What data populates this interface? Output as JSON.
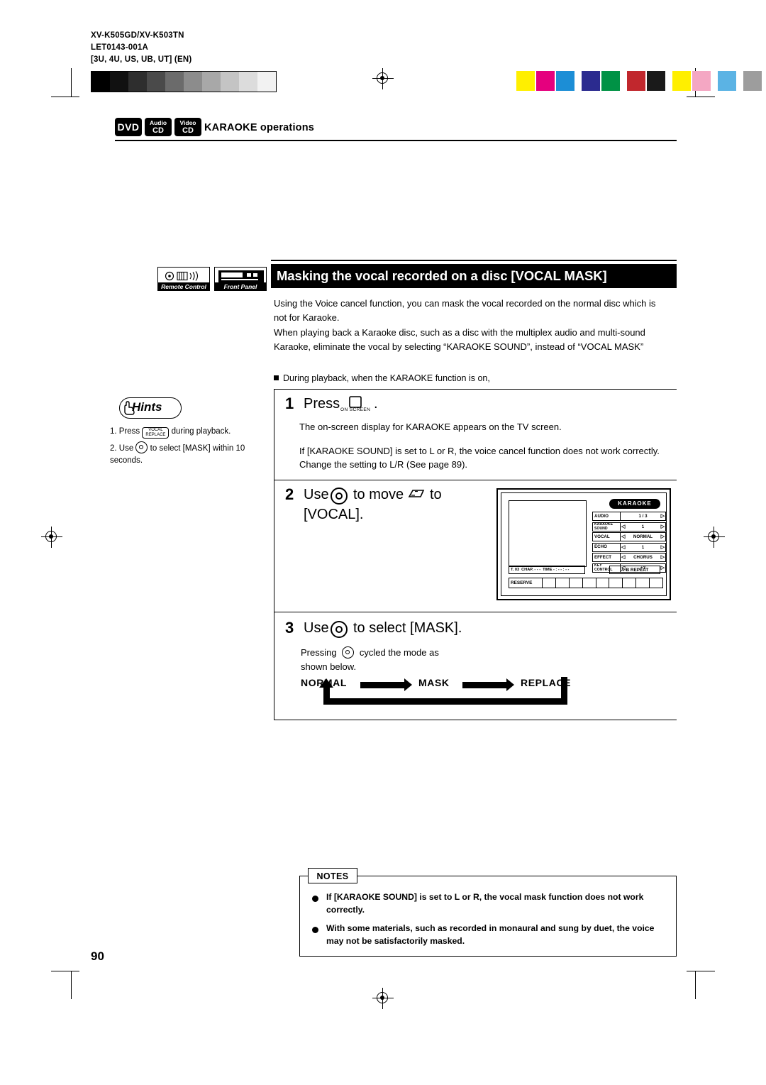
{
  "meta": {
    "model": "XV-K505GD/XV-K503TN",
    "code": "LET0143-001A",
    "region": "[3U, 4U, US, UB, UT]  (EN)"
  },
  "header": {
    "disc_icons": [
      {
        "name": "dvd",
        "line1": "",
        "line2": "DVD"
      },
      {
        "name": "audio-cd",
        "line1": "Audio",
        "line2": "CD"
      },
      {
        "name": "video-cd",
        "line1": "Video",
        "line2": "CD"
      }
    ],
    "section_title": "KARAOKE operations"
  },
  "device_icons": [
    {
      "label": "Remote Control"
    },
    {
      "label": "Front Panel"
    }
  ],
  "main": {
    "heading": "Masking the vocal recorded on a disc [VOCAL MASK]",
    "paragraphs": [
      "Using the Voice cancel function, you can mask the vocal recorded on the normal disc which is not for Karaoke.",
      "When playing back a Karaoke disc, such as a disc with the multiplex audio and multi-sound Karaoke, eliminate the vocal by selecting “KARAOKE SOUND”, instead of “VOCAL MASK”"
    ],
    "bullet": "During playback, when the KARAOKE function is on,"
  },
  "hints": {
    "title": "Hints",
    "items": [
      {
        "prefix": "1. Press",
        "button": {
          "line1": "VOCAL",
          "line2": "REPLACE"
        },
        "suffix": "during playback."
      },
      {
        "prefix": "2. Use",
        "button": {
          "line1": "",
          "line2": ""
        },
        "suffix": "to select [MASK] within 10 seconds."
      }
    ]
  },
  "steps": [
    {
      "number": "1",
      "verb": "Press",
      "icon_label": "ON SCREEN",
      "trailing": ".",
      "sub": [
        "The on-screen display for KARAOKE appears on the TV screen.",
        "If [KARAOKE SOUND] is set to L or R, the voice cancel function does not work correctly. Change the setting to L/R (See page 89)."
      ]
    },
    {
      "number": "2",
      "verb": "Use",
      "mid": "to move",
      "tail": "to",
      "line2": "[VOCAL]."
    },
    {
      "number": "3",
      "verb": "Use",
      "tail": "to select [MASK].",
      "sub": [
        "Pressing",
        "cycled the mode as",
        "shown below."
      ]
    }
  ],
  "tv_osd": {
    "badge": "KARAOKE",
    "rows": [
      {
        "name": "AUDIO",
        "name2": "",
        "value": "1 / 3",
        "left_arrow": false,
        "right_arrow": true
      },
      {
        "name": "KARAOKE",
        "name2": "SOUND",
        "value": "1",
        "left_arrow": true,
        "right_arrow": true
      },
      {
        "name": "VOCAL",
        "name2": "",
        "value": "NORMAL",
        "left_arrow": true,
        "right_arrow": true
      },
      {
        "name": "ECHO",
        "name2": "",
        "value": "1",
        "left_arrow": true,
        "right_arrow": true
      },
      {
        "name": "EFFECT",
        "name2": "",
        "value": "CHORUS",
        "left_arrow": true,
        "right_arrow": true
      },
      {
        "name": "KEY",
        "name2": "CONTROL",
        "value": "+3",
        "left_arrow": true,
        "right_arrow": true
      }
    ],
    "status_bar": [
      "T. 03",
      "CHAP. - - -",
      "TIME  - : - - : - -"
    ],
    "ab_repeat": "A-B REPEAT",
    "reserve": "RESERVE"
  },
  "cycle": {
    "labels": [
      "NORMAL",
      "MASK",
      "REPLACE"
    ]
  },
  "notes": {
    "title": "NOTES",
    "items": [
      "If [KARAOKE SOUND] is set to L or R, the vocal mask function does not work correctly.",
      "With some materials, such as recorded in monaural and sung by duet, the voice may not be satisfactorily masked."
    ]
  },
  "page_number": "90",
  "colors": {
    "grayscale": [
      "#000000",
      "#1a1a1a",
      "#333333",
      "#4d4d4d",
      "#666666",
      "#808080",
      "#999999",
      "#b3b3b3",
      "#cccccc",
      "#e6e6e6"
    ],
    "colorbar": [
      "#ffff00",
      "#ff00a0",
      "#00a0ff",
      "#1a1aa0",
      "#00a040",
      "#d01020",
      "#1a1a1a",
      "#ffff00",
      "#ff99cc",
      "#55aadd",
      "#888888"
    ]
  }
}
